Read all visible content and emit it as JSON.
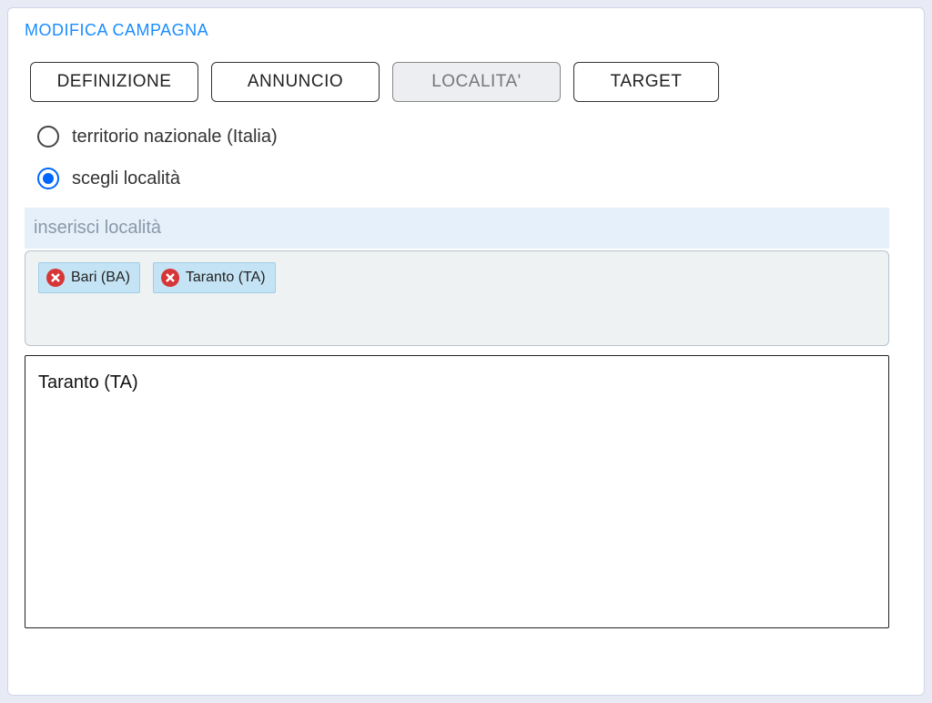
{
  "panel": {
    "title": "MODIFICA CAMPAGNA"
  },
  "tabs": [
    {
      "label": "DEFINIZIONE",
      "active": false
    },
    {
      "label": "ANNUNCIO",
      "active": false
    },
    {
      "label": "LOCALITA'",
      "active": true
    },
    {
      "label": "TARGET",
      "active": false
    }
  ],
  "locationScope": {
    "nationalLabel": "territorio nazionale (Italia)",
    "chooseLabel": "scegli località",
    "selected": "choose"
  },
  "searchPlaceholder": "inserisci località",
  "selectedLocations": [
    {
      "name": "Bari (BA)"
    },
    {
      "name": "Taranto (TA)"
    }
  ],
  "suggestions": [
    {
      "name": "Taranto (TA)"
    }
  ]
}
